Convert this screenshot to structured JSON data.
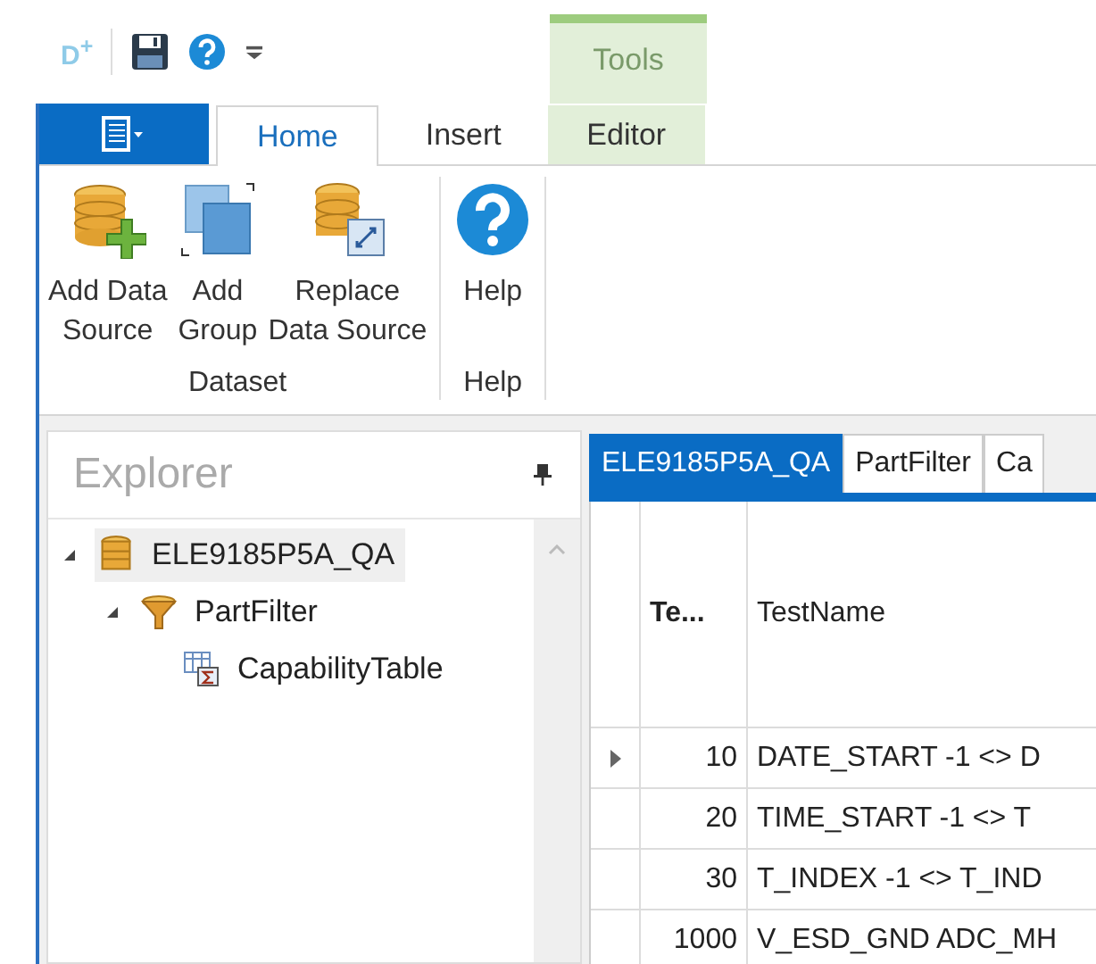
{
  "quick_access": {
    "logo": "D$^{+}$"
  },
  "contextual_group": {
    "label": "Tools"
  },
  "tabs": [
    {
      "kind": "file",
      "selected": false
    },
    {
      "kind": "tab",
      "label": "Home",
      "selected": true
    },
    {
      "kind": "tab",
      "label": "Insert",
      "selected": false
    },
    {
      "kind": "context",
      "label": "Editor",
      "selected": false
    }
  ],
  "ribbon_groups": [
    {
      "label": "Dataset",
      "buttons": [
        {
          "kind": "add-source",
          "lines": [
            "Add Data",
            "Source"
          ]
        },
        {
          "kind": "add-group",
          "lines": [
            "Add",
            "Group"
          ]
        },
        {
          "kind": "replace-source",
          "lines": [
            "Replace",
            "Data Source"
          ]
        }
      ]
    },
    {
      "label": "Help",
      "buttons": [
        {
          "kind": "help",
          "lines": [
            "Help"
          ]
        }
      ]
    }
  ],
  "explorer": {
    "title": "Explorer",
    "tree": [
      {
        "label": "ELE9185P5A_QA",
        "kind": "database",
        "selected": true,
        "expanded": true,
        "children": [
          {
            "label": "PartFilter",
            "kind": "filter",
            "selected": false,
            "expanded": true,
            "children": [
              {
                "label": "CapabilityTable",
                "kind": "table",
                "selected": false
              }
            ]
          }
        ]
      }
    ]
  },
  "document_tabs": [
    {
      "label": "ELE9185P5A_QA",
      "selected": true
    },
    {
      "label": "PartFilter",
      "selected": false
    },
    {
      "label": "Ca",
      "selected": false
    }
  ],
  "table": {
    "columns": [
      "Te...",
      "TestName"
    ],
    "rows": [
      {
        "cells": [
          "10",
          "DATE_START  -1 <> D"
        ],
        "selected": true
      },
      {
        "cells": [
          "20",
          "TIME_START  -1 <> T"
        ],
        "selected": false
      },
      {
        "cells": [
          "30",
          "T_INDEX  -1 <> T_IND"
        ],
        "selected": false
      },
      {
        "cells": [
          "1000",
          "V_ESD_GND ADC_MH"
        ],
        "selected": false
      }
    ]
  }
}
